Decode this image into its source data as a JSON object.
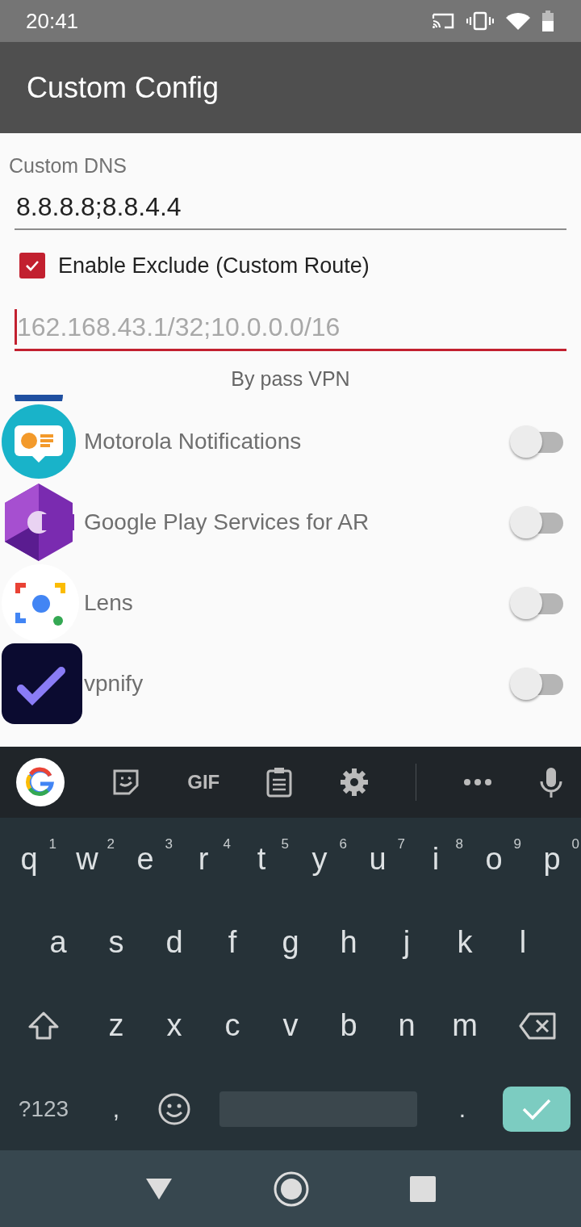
{
  "status_bar": {
    "time": "20:41"
  },
  "app_bar": {
    "title": "Custom Config"
  },
  "dns": {
    "label": "Custom DNS",
    "value": "8.8.8.8;8.8.4.4"
  },
  "exclude": {
    "label": "Enable Exclude (Custom Route)",
    "checked": true
  },
  "route": {
    "placeholder": "162.168.43.1/32;10.0.0.0/16",
    "focused": true
  },
  "section_label": "By pass VPN",
  "apps": [
    {
      "name": "Motorola Notifications",
      "on": false
    },
    {
      "name": "Google Play Services for AR",
      "on": false
    },
    {
      "name": "Lens",
      "on": false
    },
    {
      "name": "vpnify",
      "on": false
    }
  ],
  "keyboard": {
    "toolbar": [
      {
        "kind": "google"
      },
      {
        "kind": "sticker"
      },
      {
        "kind": "gif",
        "label": "GIF"
      },
      {
        "kind": "clipboard"
      },
      {
        "kind": "settings"
      },
      {
        "kind": "divider"
      },
      {
        "kind": "more"
      },
      {
        "kind": "mic"
      }
    ],
    "rows": [
      [
        {
          "kind": "letter",
          "label": "q",
          "hint": "1"
        },
        {
          "kind": "letter",
          "label": "w",
          "hint": "2"
        },
        {
          "kind": "letter",
          "label": "e",
          "hint": "3"
        },
        {
          "kind": "letter",
          "label": "r",
          "hint": "4"
        },
        {
          "kind": "letter",
          "label": "t",
          "hint": "5"
        },
        {
          "kind": "letter",
          "label": "y",
          "hint": "6"
        },
        {
          "kind": "letter",
          "label": "u",
          "hint": "7"
        },
        {
          "kind": "letter",
          "label": "i",
          "hint": "8"
        },
        {
          "kind": "letter",
          "label": "o",
          "hint": "9"
        },
        {
          "kind": "letter",
          "label": "p",
          "hint": "0"
        }
      ],
      [
        {
          "kind": "letter",
          "label": "a"
        },
        {
          "kind": "letter",
          "label": "s"
        },
        {
          "kind": "letter",
          "label": "d"
        },
        {
          "kind": "letter",
          "label": "f"
        },
        {
          "kind": "letter",
          "label": "g"
        },
        {
          "kind": "letter",
          "label": "h"
        },
        {
          "kind": "letter",
          "label": "j"
        },
        {
          "kind": "letter",
          "label": "k"
        },
        {
          "kind": "letter",
          "label": "l"
        }
      ],
      [
        {
          "kind": "shift"
        },
        {
          "kind": "letter",
          "label": "z"
        },
        {
          "kind": "letter",
          "label": "x"
        },
        {
          "kind": "letter",
          "label": "c"
        },
        {
          "kind": "letter",
          "label": "v"
        },
        {
          "kind": "letter",
          "label": "b"
        },
        {
          "kind": "letter",
          "label": "n"
        },
        {
          "kind": "letter",
          "label": "m"
        },
        {
          "kind": "backspace"
        }
      ]
    ],
    "bottom_row": [
      {
        "kind": "symbols",
        "label": "?123"
      },
      {
        "kind": "punct",
        "label": ","
      },
      {
        "kind": "emoji"
      },
      {
        "kind": "space"
      },
      {
        "kind": "punct",
        "label": "."
      },
      {
        "kind": "enter"
      }
    ]
  }
}
